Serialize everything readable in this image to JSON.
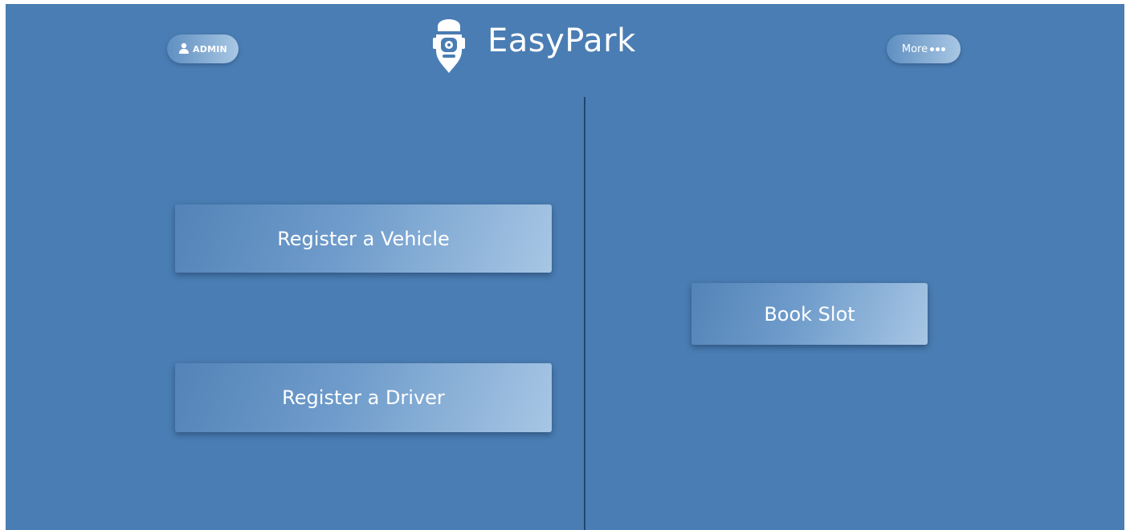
{
  "header": {
    "brand_name": "EasyPark",
    "logo_icon": "parking-pin-icon",
    "admin_label": "ADMIN",
    "admin_icon": "user-icon",
    "more_label": "More",
    "more_icon": "more-dots-icon"
  },
  "actions": {
    "register_vehicle_label": "Register a Vehicle",
    "register_driver_label": "Register a Driver",
    "book_slot_label": "Book Slot"
  },
  "colors": {
    "background": "#4a7db3",
    "divider": "#23456b",
    "text": "#ffffff",
    "button_gradient_start": "#5383b8",
    "button_gradient_end": "#a7c6e4"
  }
}
